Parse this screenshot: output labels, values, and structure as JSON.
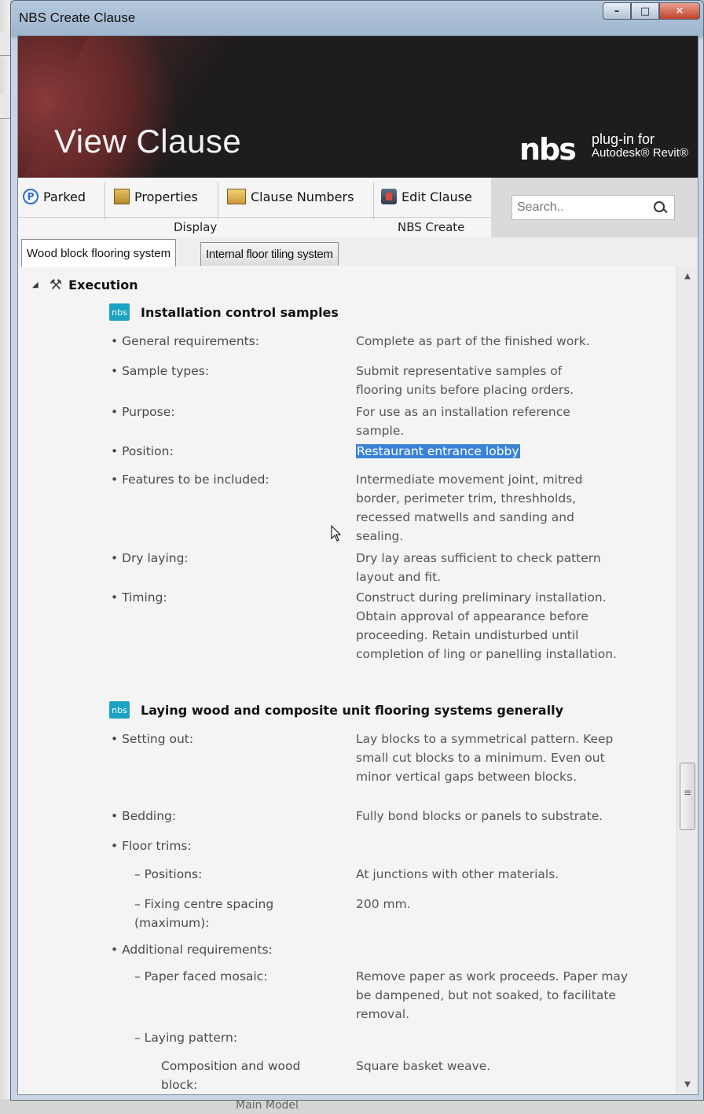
{
  "window": {
    "title": "NBS Create Clause",
    "buttons": [
      "–",
      "□",
      "✕"
    ]
  },
  "banner": {
    "title": "View Clause",
    "logo": "nbs",
    "plugin_line1": "plug-in for",
    "plugin_line2": "Autodesk® Revit®"
  },
  "toolbar": {
    "parked": "Parked",
    "properties": "Properties",
    "clause_numbers": "Clause Numbers",
    "edit_clause": "Edit Clause",
    "group_display": "Display",
    "group_nbs_create": "NBS Create",
    "search_placeholder": "Search.."
  },
  "tabs": [
    "Wood block flooring system",
    "Internal floor tiling system"
  ],
  "content": {
    "section": "Execution",
    "clauses": [
      {
        "badge": "nbs",
        "title": "Installation control samples",
        "items": [
          {
            "label": "• General requirements:",
            "value": "Complete as part of the finished work."
          },
          {
            "label": "• Sample types:",
            "value": "Submit representative samples of flooring units before placing orders."
          },
          {
            "label": "• Purpose:",
            "value": "For use as an installation reference sample."
          },
          {
            "label": "• Position:",
            "value": "Restaurant entrance lobby"
          },
          {
            "label": "• Features to be included:",
            "value": "Intermediate movement joint, mitred border, perimeter trim, threshholds, recessed matwells and sanding and sealing."
          },
          {
            "label": "• Dry laying:",
            "value": "Dry lay areas sufficient to check pattern layout and fit."
          },
          {
            "label": "• Timing:",
            "value": "Construct during preliminary installation. Obtain approval of appearance before proceeding. Retain undisturbed until completion of ling or panelling installation."
          }
        ]
      },
      {
        "badge": "nbs",
        "title": "Laying wood and composite unit flooring systems generally",
        "items": [
          {
            "label": "• Setting out:",
            "value": "Lay blocks to a symmetrical pattern. Keep small cut blocks to a minimum. Even out minor vertical gaps between blocks."
          },
          {
            "label": "• Bedding:",
            "value": "Fully bond blocks or panels to substrate."
          },
          {
            "label": "• Floor trims:",
            "value": ""
          },
          {
            "label": "– Positions:",
            "value": "At junctions with other materials."
          },
          {
            "label": "– Fixing centre spacing (maximum):",
            "value": "200 mm."
          },
          {
            "label": "• Additional requirements:",
            "value": ""
          },
          {
            "label": "– Paper faced mosaic:",
            "value": "Remove paper as work proceeds. Paper may be dampened, but not soaked, to facilitate removal."
          },
          {
            "label": "– Laying pattern:",
            "value": ""
          },
          {
            "label": "Composition and wood block:",
            "value": "Square basket weave."
          }
        ]
      }
    ]
  },
  "background_app": {
    "status_text": "Main Model"
  }
}
